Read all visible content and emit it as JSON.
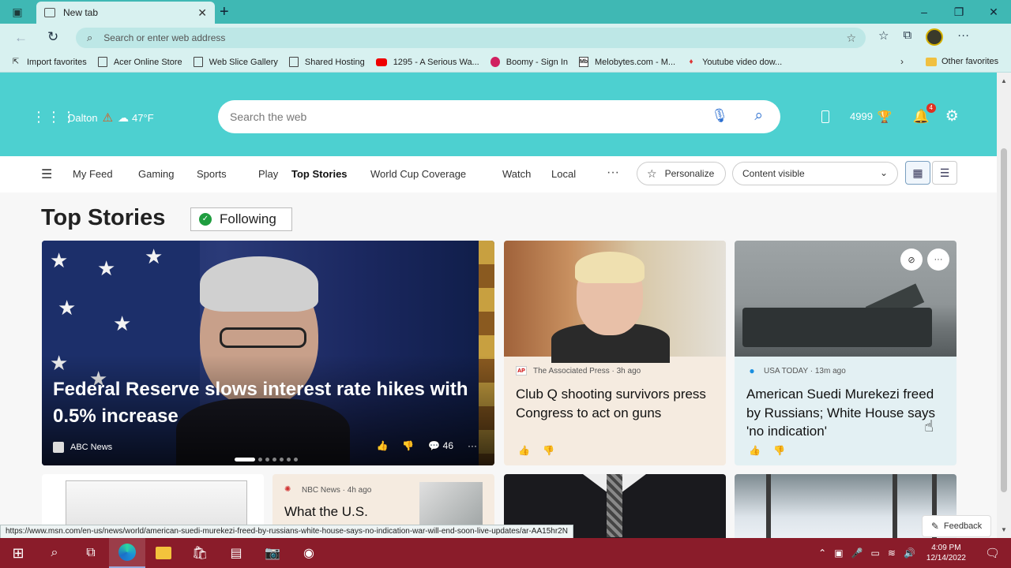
{
  "browser": {
    "tab_title": "New tab",
    "address_placeholder": "Search or enter web address",
    "favorites": [
      {
        "label": "Import favorites",
        "icon": "import-icon"
      },
      {
        "label": "Acer Online Store",
        "icon": "doc-icon"
      },
      {
        "label": "Web Slice Gallery",
        "icon": "doc-icon"
      },
      {
        "label": "Shared Hosting",
        "icon": "doc-icon"
      },
      {
        "label": "1295 - A Serious Wa...",
        "icon": "youtube-icon"
      },
      {
        "label": "Boomy - Sign In",
        "icon": "boomy-icon"
      },
      {
        "label": "Melobytes.com - M...",
        "icon": "mb-icon"
      },
      {
        "label": "Youtube video dow...",
        "icon": "yd-icon"
      }
    ],
    "other_favorites": "Other favorites",
    "status_url": "https://www.msn.com/en-us/news/world/american-suedi-murekezi-freed-by-russians-white-house-says-no-indication-war-will-end-soon-live-updates/ar-AA15hr2N"
  },
  "header": {
    "location": "Dalton",
    "temperature": "47°F",
    "search_placeholder": "Search the web",
    "rewards_points": "4999",
    "notification_count": "4"
  },
  "nav": {
    "tabs": [
      "My Feed",
      "Gaming",
      "Sports",
      "Play",
      "Top Stories",
      "World Cup Coverage",
      "Watch",
      "Local"
    ],
    "active_tab": "Top Stories",
    "more": "···",
    "personalize": "Personalize",
    "content_select": "Content visible"
  },
  "section": {
    "title": "Top Stories",
    "following": "Following"
  },
  "hero": {
    "headline": "Federal Reserve slows interest rate hikes with 0.5% increase",
    "source": "ABC News",
    "comments": "46"
  },
  "cards": [
    {
      "source": "The Associated Press · 3h ago",
      "logo": "AP",
      "title": "Club Q shooting survivors press Congress to act on guns"
    },
    {
      "source": "USA TODAY · 13m ago",
      "logo": "●",
      "title": "American Suedi Murekezi freed by Russians; White House says 'no indication'"
    }
  ],
  "row2": {
    "nbc_source": "NBC News · 4h ago",
    "nbc_title": "What the U.S."
  },
  "feedback": "Feedback",
  "taskbar": {
    "time": "4:09 PM",
    "date": "12/14/2022"
  },
  "colors": {
    "header_bg": "#4dd0d0",
    "taskbar_bg": "#8a1c2a",
    "accent_blue": "#2a6ed0"
  }
}
